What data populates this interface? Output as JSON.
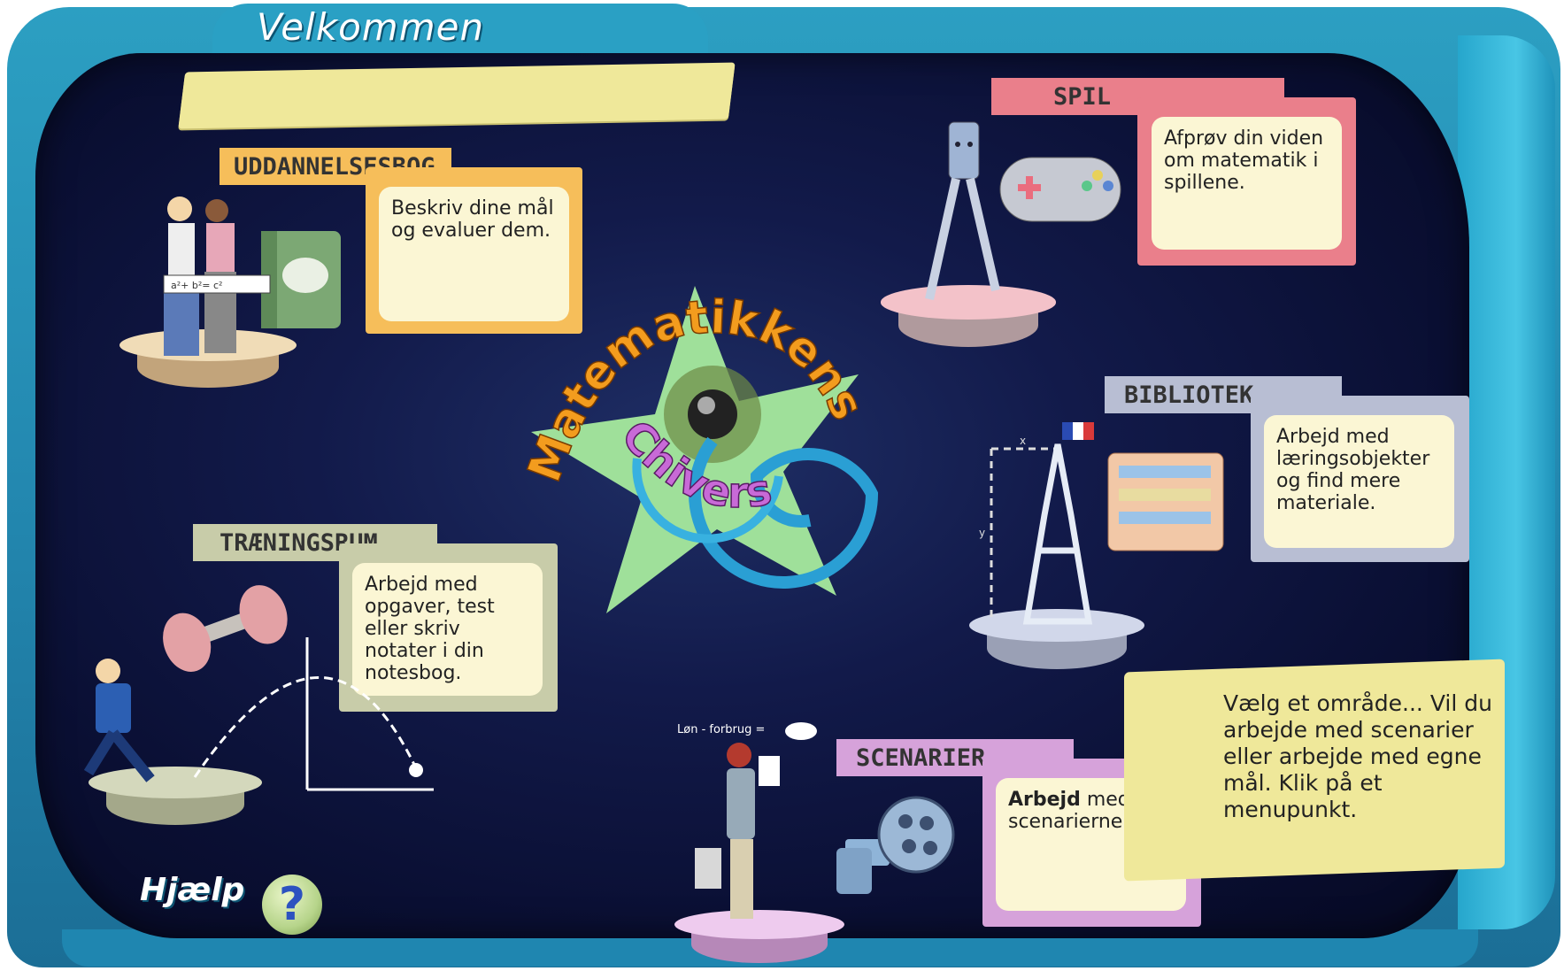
{
  "header": {
    "title": "Velkommen"
  },
  "logo": {
    "line1": "Matematikkens",
    "line2": "Chivers"
  },
  "menus": {
    "uddannelsesbog": {
      "label": "UDDANNELSESBOG",
      "desc": "Beskriv dine mål og evaluer dem.",
      "color": "#f6be5a"
    },
    "spil": {
      "label": "SPIL",
      "desc": "Afprøv din viden om matematik i spillene.",
      "color": "#ea7f8b"
    },
    "bibliotek": {
      "label": "BIBLIOTEK",
      "desc": "Arbejd med læringsobjekter og find mere materiale.",
      "color": "#b8bed3"
    },
    "traeningsrum": {
      "label": "TRÆNINGSRUM",
      "desc": "Arbejd med opgaver, test eller skriv notater i din notesbog.",
      "color": "#c8cca9"
    },
    "scenarier": {
      "label": "SCENARIER",
      "desc_bold": "Arbejd",
      "desc_rest": " med scenarierne.",
      "color": "#d6a2da"
    }
  },
  "illustrations": {
    "formula_sign": "a²+ b²= c²",
    "graph_axis_x": "x",
    "graph_axis_y": "y",
    "budget_text": "Løn - forbrug ="
  },
  "info": {
    "text": "Vælg et område... Vil du arbejde med scenarier eller arbejde med egne mål. Klik på et menupunkt."
  },
  "help": {
    "label": "Hjælp",
    "icon_glyph": "?"
  }
}
